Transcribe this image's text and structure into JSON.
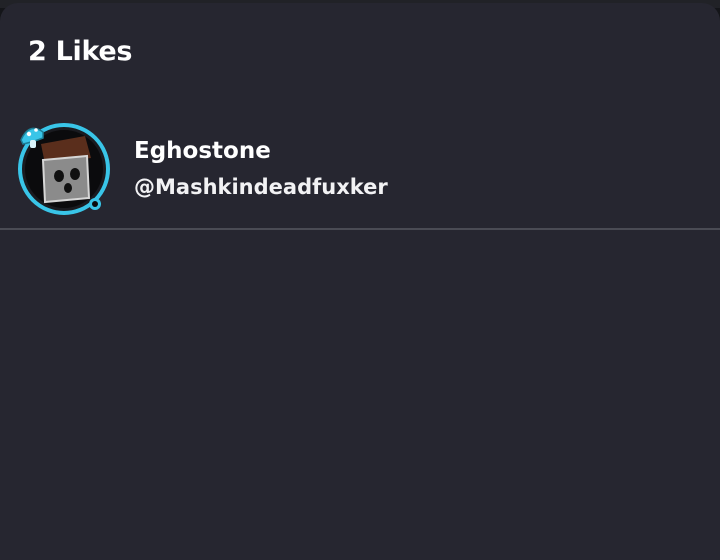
{
  "likes_sheet": {
    "title": "2 Likes",
    "users": [
      {
        "name": "Eghostone",
        "handle": "@Mashkindeadfuxker",
        "avatar_icon": "ghost-face-avatar-icon",
        "ring_color": "#39c5e8"
      }
    ]
  },
  "colors": {
    "sheet_background": "#262630",
    "divider": "#4a4b54",
    "text": "#ffffff",
    "accent": "#39c5e8"
  }
}
